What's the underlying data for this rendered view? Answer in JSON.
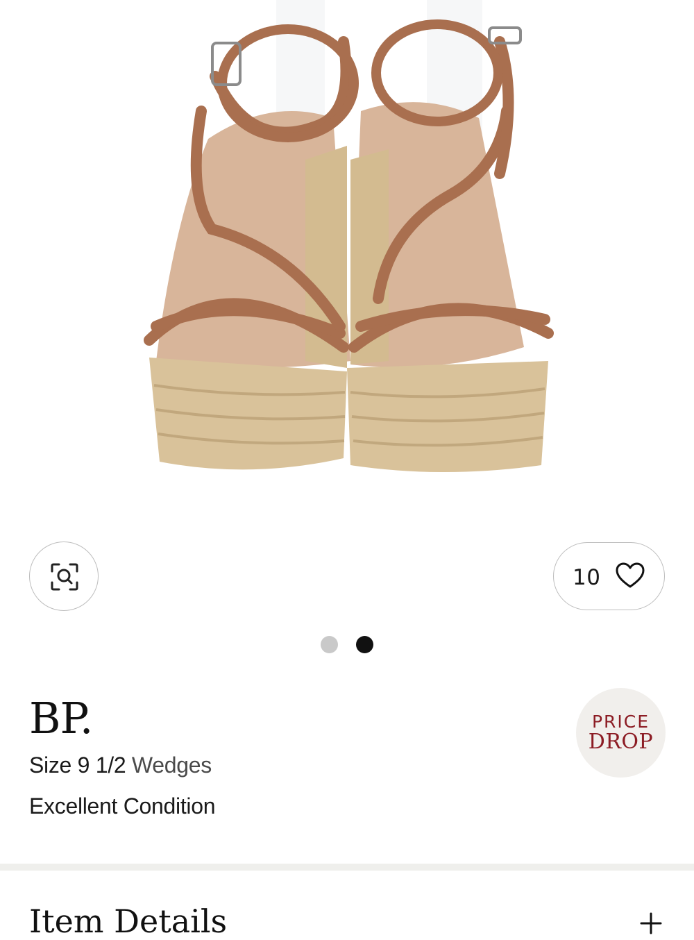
{
  "product": {
    "image_alt": "Tan strappy espadrille wedge sandals, front view",
    "like_count": "10",
    "brand": "BP.",
    "size_prefix": "Size 9 1/2",
    "category": "Wedges",
    "condition": "Excellent Condition",
    "badge": {
      "line1": "PRICE",
      "line2": "DROP"
    }
  },
  "carousel": {
    "total": 2,
    "active_index": 1
  },
  "sections": {
    "item_details": "Item Details"
  },
  "icons": {
    "zoom": "visual-search-icon",
    "favorite": "heart-icon",
    "expand": "plus-icon"
  },
  "colors": {
    "badge_text": "#8c1c24",
    "badge_bg": "#f1efec",
    "strap": "#a96f4f",
    "jute": "#d9c29a",
    "dot_active": "#111111",
    "dot_inactive": "#c9c9c9"
  }
}
